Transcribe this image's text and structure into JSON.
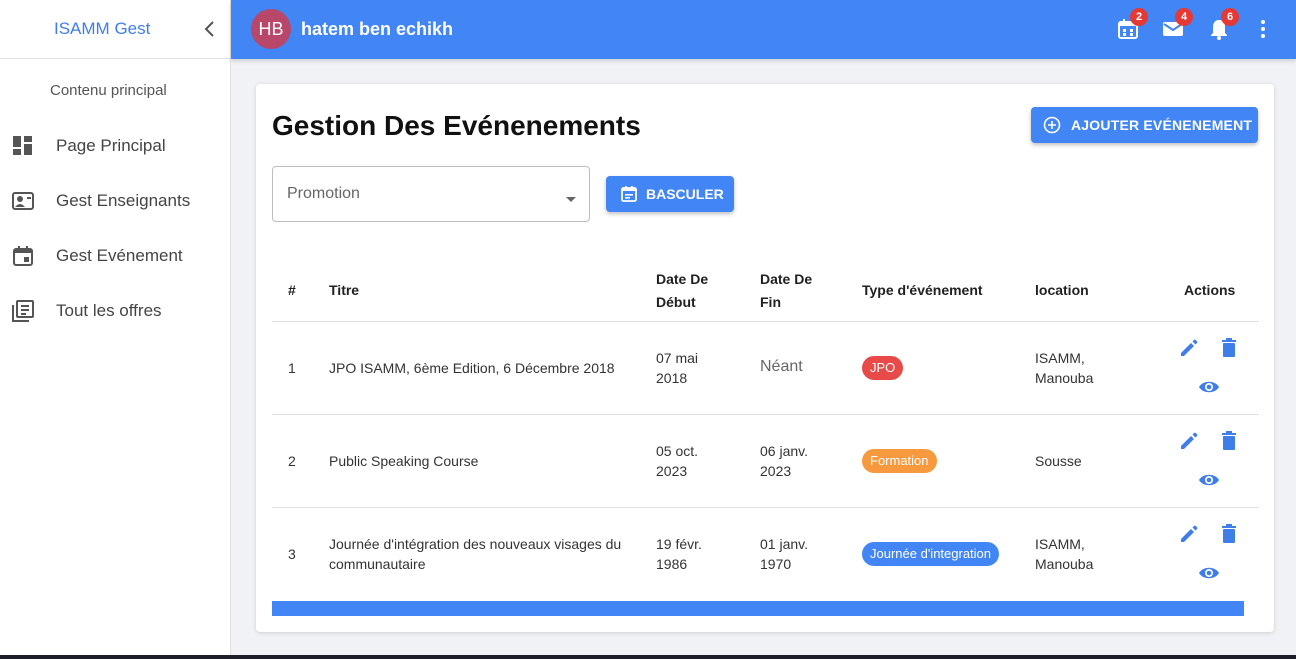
{
  "sidebar": {
    "brand": "ISAMM Gest",
    "section_title": "Contenu principal",
    "items": [
      {
        "label": "Page Principal"
      },
      {
        "label": "Gest Enseignants"
      },
      {
        "label": "Gest Evénement"
      },
      {
        "label": "Tout les offres"
      }
    ]
  },
  "topbar": {
    "avatar_initials": "HB",
    "user_name": "hatem ben echikh",
    "badges": {
      "calendar": "2",
      "mail": "4",
      "notifications": "6"
    }
  },
  "main": {
    "title": "Gestion Des Evénenements",
    "add_button": "AJOUTER EVÉNENEMENT",
    "promotion_placeholder": "Promotion",
    "toggle_button": "BASCULER"
  },
  "table": {
    "headers": {
      "index": "#",
      "title": "Titre",
      "start": "Date De Début",
      "end": "Date De Fin",
      "type": "Type d'événement",
      "location": "location",
      "actions": "Actions"
    },
    "rows": [
      {
        "index": "1",
        "title": "JPO ISAMM, 6ème Edition, 6 Décembre 2018",
        "start": "07 mai 2018",
        "end": "Néant",
        "type": "JPO",
        "type_color": "#e84a4a",
        "location": "ISAMM, Manouba"
      },
      {
        "index": "2",
        "title": "Public Speaking Course",
        "start": "05 oct. 2023",
        "end": "06 janv. 2023",
        "type": "Formation",
        "type_color": "#f7993d",
        "location": "Sousse"
      },
      {
        "index": "3",
        "title": "Journée d'intégration des nouveaux visages du communautaire",
        "start": "19 févr. 1986",
        "end": "01 janv. 1970",
        "type": "Journée d'integration",
        "type_color": "#4285f4",
        "location": "ISAMM, Manouba"
      }
    ]
  },
  "colors": {
    "primary": "#4285f4",
    "danger": "#e53935",
    "avatar": "#b8476a"
  }
}
